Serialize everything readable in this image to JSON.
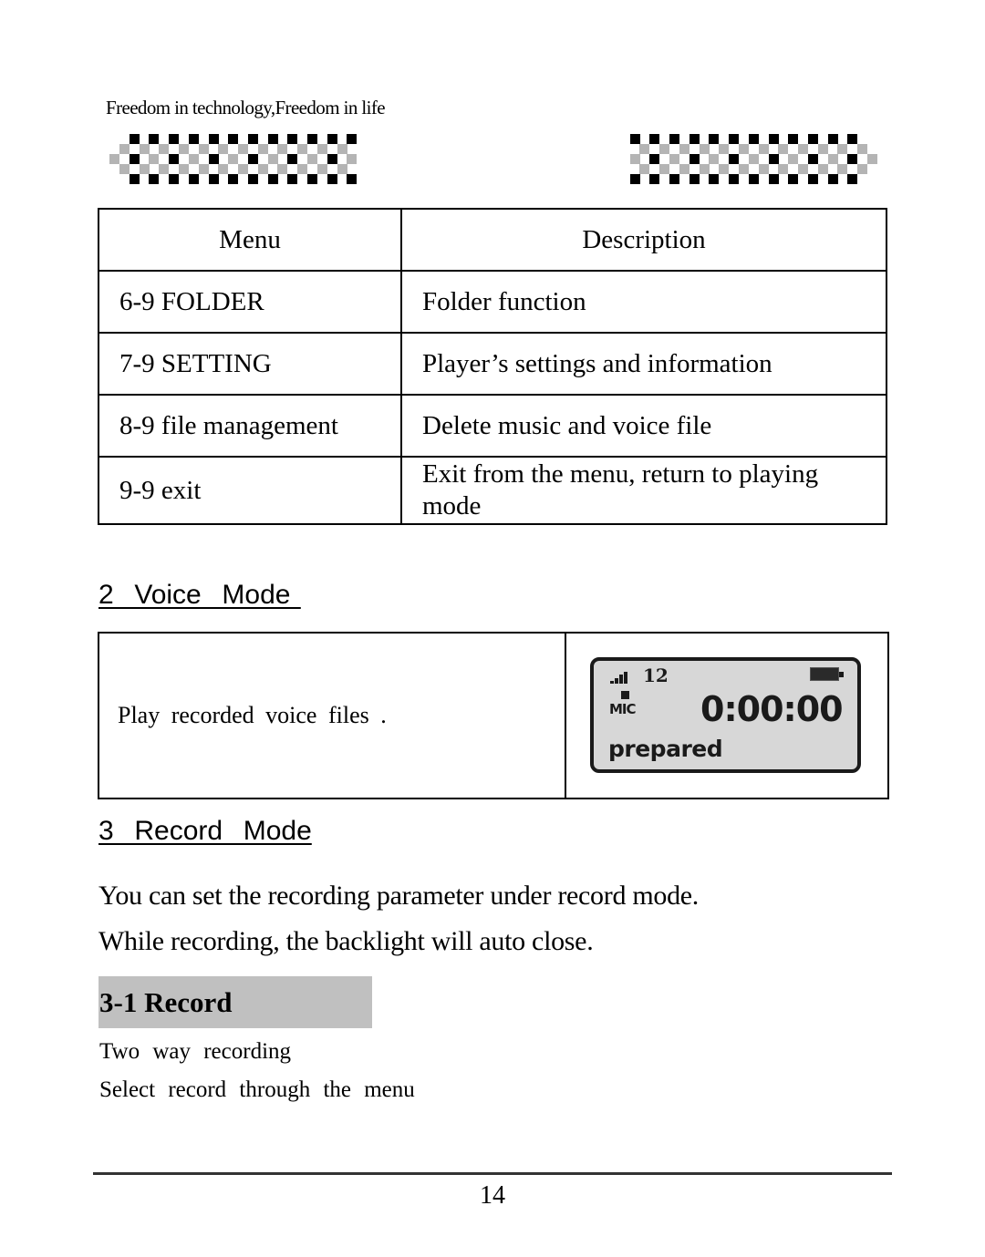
{
  "header": {
    "tagline": "Freedom in technology,Freedom in life",
    "decor_left_icon": "checker-pattern-icon",
    "decor_right_icon": "checker-pattern-icon"
  },
  "menu_table": {
    "columns": [
      "Menu",
      "Description"
    ],
    "rows": [
      {
        "menu": "6-9 FOLDER",
        "description": "Folder function"
      },
      {
        "menu": "7-9 SETTING",
        "description": "Player’s settings and information"
      },
      {
        "menu": "8-9 file management",
        "description": "Delete music and voice file"
      },
      {
        "menu": "9-9 exit",
        "description": "Exit from the menu, return to playing mode"
      }
    ]
  },
  "voice_mode": {
    "heading": "2  Voice  Mode ",
    "description": "Play recorded voice files .",
    "lcd": {
      "signal_icon": "signal-bars-icon",
      "volume": "12",
      "battery_icon": "battery-icon",
      "record_indicator_icon": "record-square-icon",
      "source": "MIC",
      "time": "0:00:00",
      "status": "prepared"
    }
  },
  "record_mode": {
    "heading": "3  Record  Mode",
    "paragraphs": [
      "You can set the recording parameter under record mode.",
      "While recording, the backlight will auto close."
    ],
    "subsection": {
      "heading": "3-1 Record",
      "lines": [
        "Two way recording",
        "Select record through the menu"
      ]
    }
  },
  "footer": {
    "page_number": "14"
  },
  "colors": {
    "checker_dark": "#000000",
    "checker_light": "#b4b4b4",
    "subheading_bg": "#c0c0c0",
    "lcd_bg": "#d7d7d7"
  }
}
